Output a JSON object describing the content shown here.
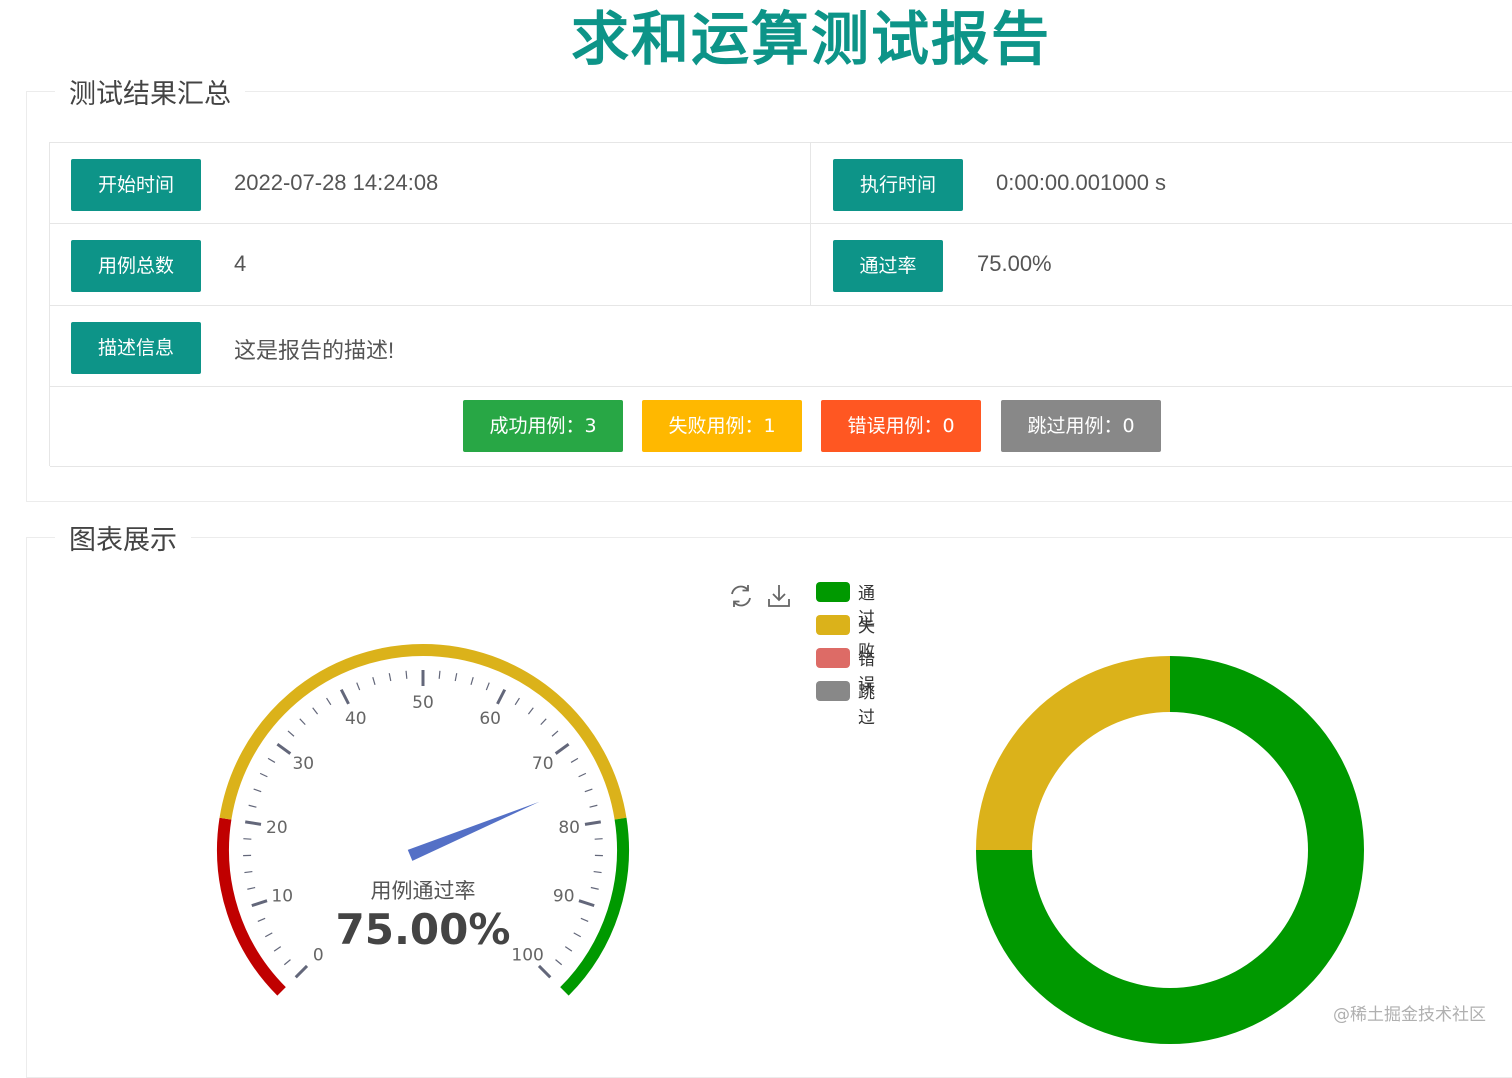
{
  "page": {
    "title": "求和运算测试报告"
  },
  "summary": {
    "legend": "测试结果汇总",
    "start_time_label": "开始时间",
    "start_time_value": "2022-07-28 14:24:08",
    "exec_time_label": "执行时间",
    "exec_time_value": "0:00:00.001000 s",
    "total_label": "用例总数",
    "total_value": "4",
    "pass_rate_label": "通过率",
    "pass_rate_value": "75.00%",
    "desc_label": "描述信息",
    "desc_value": "这是报告的描述!",
    "success_btn": "成功用例：3",
    "fail_btn": "失败用例：1",
    "error_btn": "错误用例：0",
    "skip_btn": "跳过用例：0"
  },
  "charts_section": {
    "legend": "图表展示"
  },
  "toolbox": {
    "refresh_icon": "refresh-icon",
    "download_icon": "download-icon"
  },
  "colors": {
    "teal": "#0d9488",
    "success": "#28a745",
    "fail": "#ffb800",
    "error": "#ff5722",
    "skip": "#888888",
    "pass_series": "#009900",
    "fail_series": "#dbb21a",
    "error_series": "#dd6b66",
    "skip_series": "#888888",
    "gauge_low": "#c00000",
    "gauge_mid": "#dbb21a",
    "gauge_high": "#009900",
    "pointer": "#5470c6"
  },
  "chart_data": [
    {
      "type": "gauge",
      "title": "用例通过率",
      "value": 75.0,
      "value_label": "75.00%",
      "min": 0,
      "max": 100,
      "tick_labels": [
        "0",
        "10",
        "20",
        "30",
        "40",
        "50",
        "60",
        "70",
        "80",
        "90",
        "100"
      ],
      "bands": [
        {
          "from": 0,
          "to": 20,
          "color": "#c00000"
        },
        {
          "from": 20,
          "to": 80,
          "color": "#dbb21a"
        },
        {
          "from": 80,
          "to": 100,
          "color": "#009900"
        }
      ]
    },
    {
      "type": "pie",
      "donut": true,
      "legend": [
        "通过",
        "失败",
        "错误",
        "跳过"
      ],
      "values": [
        3,
        1,
        0,
        0
      ],
      "colors": [
        "#009900",
        "#dbb21a",
        "#dd6b66",
        "#888888"
      ]
    }
  ],
  "watermark": "@稀土掘金技术社区"
}
